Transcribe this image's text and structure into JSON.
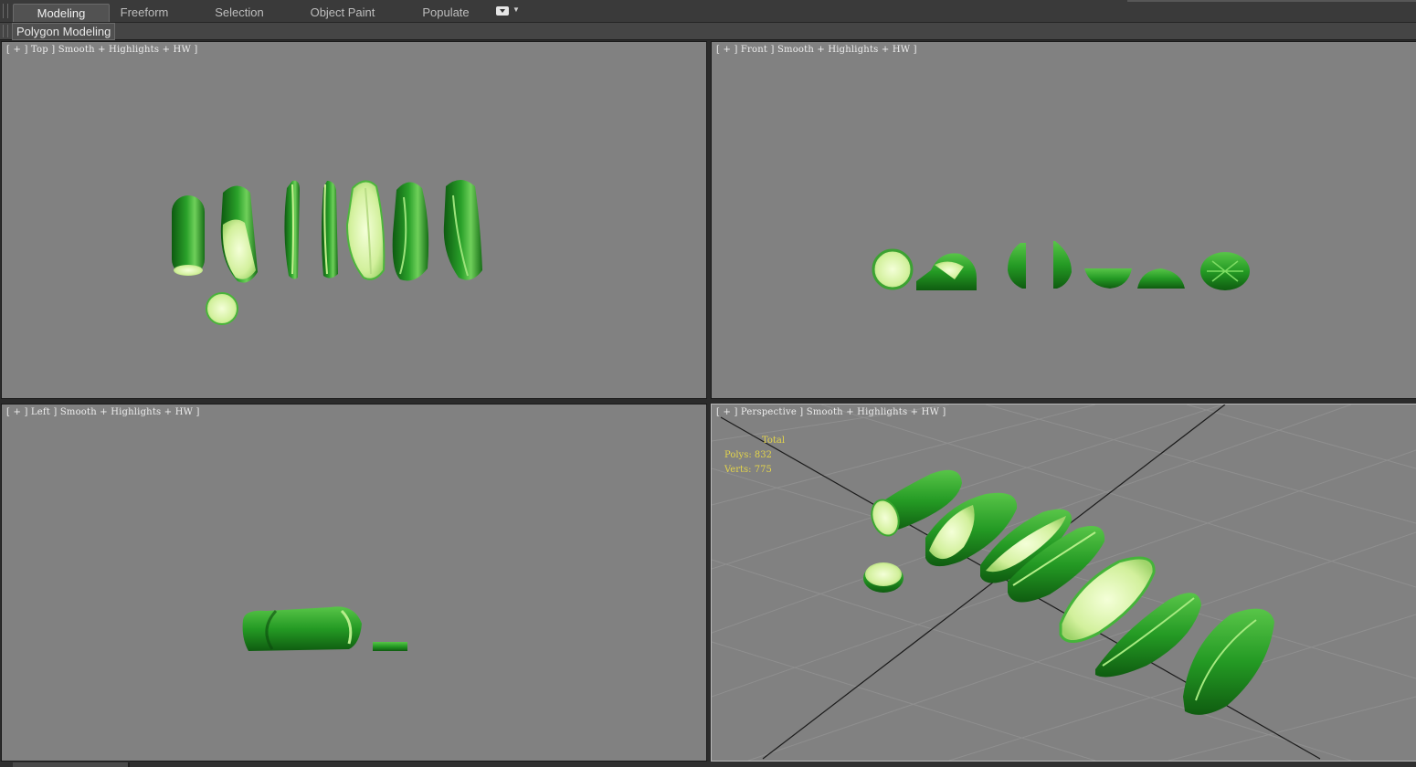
{
  "ribbon": {
    "tabs": [
      {
        "label": "Modeling",
        "active": true
      },
      {
        "label": "Freeform",
        "active": false
      },
      {
        "label": "Selection",
        "active": false
      },
      {
        "label": "Object Paint",
        "active": false
      },
      {
        "label": "Populate",
        "active": false
      }
    ],
    "toggle_icon": "minimize-ribbon-icon",
    "panel_label": "Polygon Modeling"
  },
  "viewports": {
    "top": {
      "label": "[ + ] Top ] Smooth + Highlights + HW ]"
    },
    "front": {
      "label": "[ + ] Front ] Smooth + Highlights + HW ]"
    },
    "left": {
      "label": "[ + ] Left ] Smooth + Highlights + HW ]"
    },
    "perspective": {
      "label": "[ + ] Perspective ] Smooth + Highlights + HW ]",
      "stats": {
        "total_label": "Total",
        "polys_label": "Polys:",
        "polys_value": "832",
        "verts_label": "Verts:",
        "verts_value": "775"
      }
    }
  },
  "colors": {
    "viewport_bg": "#818181",
    "cucumber_skin": "#1f8a1f",
    "cucumber_flesh": "#d9f5a8",
    "stats_text": "#e3d44a"
  }
}
